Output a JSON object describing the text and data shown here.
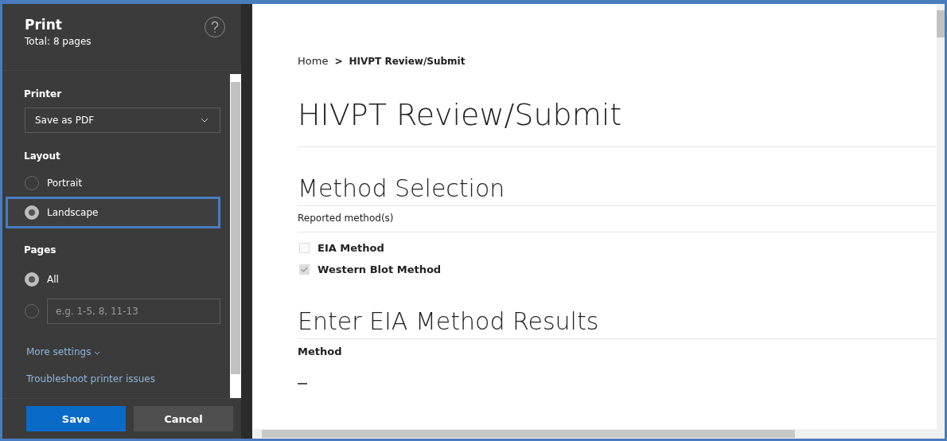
{
  "print_panel": {
    "title": "Print",
    "subtitle": "Total: 8 pages",
    "printer": {
      "label": "Printer",
      "value": "Save as PDF"
    },
    "layout": {
      "label": "Layout",
      "options": [
        {
          "label": "Portrait",
          "selected": false,
          "highlighted": false
        },
        {
          "label": "Landscape",
          "selected": true,
          "highlighted": true
        }
      ]
    },
    "pages": {
      "label": "Pages",
      "options": [
        {
          "kind": "label",
          "label": "All",
          "selected": true
        },
        {
          "kind": "field",
          "placeholder": "e.g. 1-5, 8, 11-13",
          "selected": false
        }
      ]
    },
    "more_settings": "More settings",
    "troubleshoot": "Troubleshoot printer issues",
    "buttons": [
      {
        "label": "Save",
        "kind": "primary"
      },
      {
        "label": "Cancel",
        "kind": "secondary"
      }
    ]
  },
  "preview": {
    "breadcrumb": {
      "home": "Home",
      "separator": ">",
      "current": "HIVPT Review/Submit"
    },
    "title": "HIVPT Review/Submit",
    "method_selection": {
      "heading": "Method Selection",
      "label": "Reported method(s)",
      "methods": [
        {
          "label": "EIA Method",
          "checked": false
        },
        {
          "label": "Western Blot Method",
          "checked": true
        }
      ]
    },
    "results": {
      "heading": "Enter EIA Method Results",
      "label": "Method"
    }
  }
}
